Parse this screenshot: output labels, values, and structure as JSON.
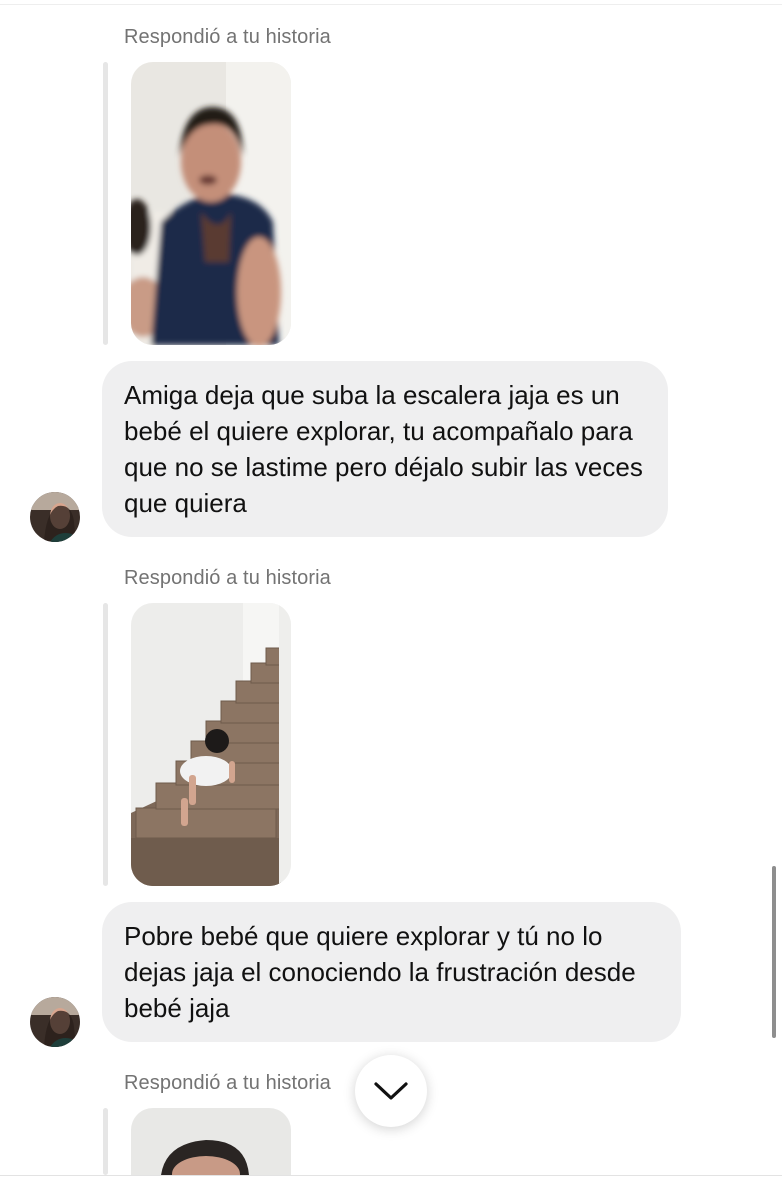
{
  "messages": [
    {
      "reply_label": "Respondió a tu historia",
      "story_thumbnail": "woman-selfie-story",
      "text": "Amiga deja que suba la escalera jaja es un bebé el quiere explorar, tu acompañalo para que no se lastime pero déjalo subir las veces que quiera"
    },
    {
      "reply_label": "Respondió a tu historia",
      "story_thumbnail": "baby-climbing-stairs-story",
      "text": "Pobre bebé que quiere explorar y tú no lo dejas jaja el conociendo la frustración desde bebé jaja"
    },
    {
      "reply_label": "Respondió a tu historia",
      "story_thumbnail": "woman-portrait-story",
      "text": ""
    }
  ],
  "colors": {
    "bubble": "#efeff0",
    "label": "#737373",
    "story_bar": "#e6e6e6"
  },
  "controls": {
    "jump_icon": "chevron-down-icon"
  }
}
